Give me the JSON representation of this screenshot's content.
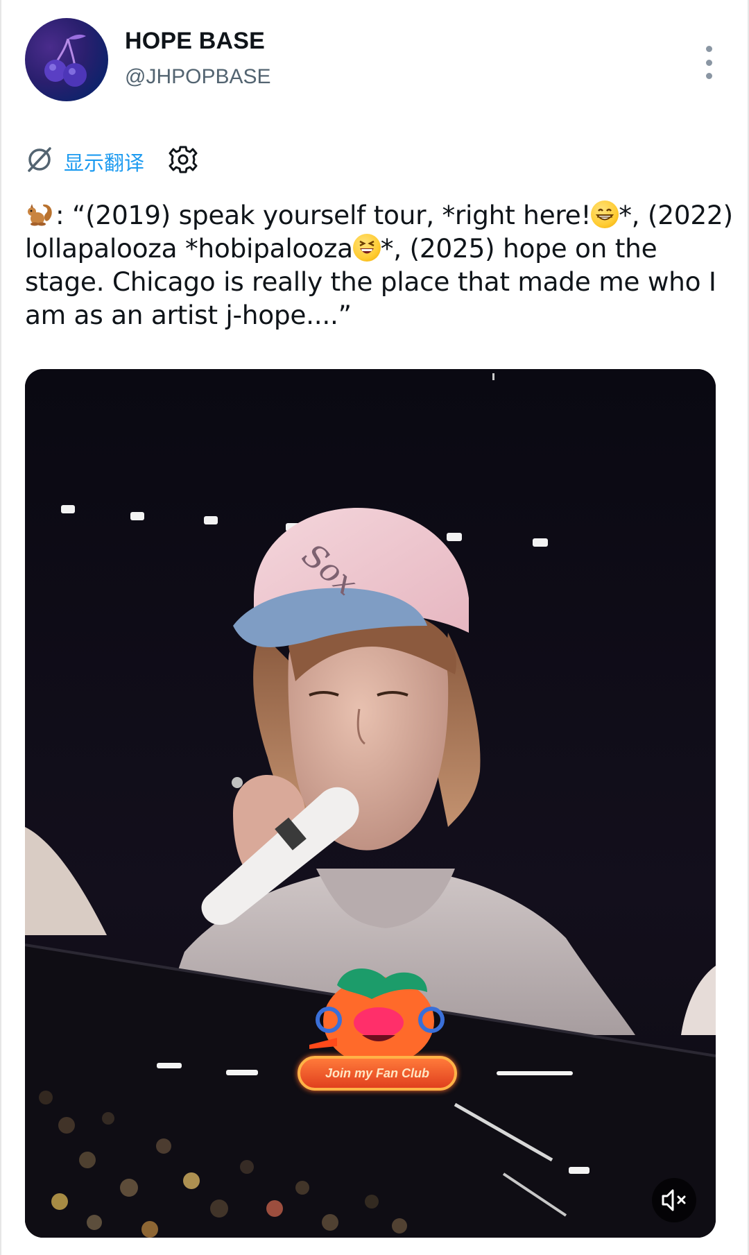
{
  "post": {
    "author": {
      "display_name": "HOPE BASE",
      "handle": "@JHPOPBASE",
      "avatar_icon": "cherry-icon"
    },
    "more_icon": "more-vertical-icon",
    "translate": {
      "label": "显示翻译",
      "icon": "translate-slash-icon",
      "settings_icon": "gear-icon"
    },
    "text_lines": [
      [
        ": “(2019) speak yourself tour, *right here!",
        "*, (2022)"
      ],
      [
        "lollapalooza *hobipalooza",
        "*, (2025) hope on the"
      ],
      [
        "stage. Chicago is really the place that made me who I"
      ],
      [
        "am as an artist j-hope....”"
      ]
    ],
    "media": {
      "type": "video",
      "overlay_badge": "Join my Fan Club",
      "mute_icon": "volume-muted-icon",
      "cap_logo": "Sox"
    }
  },
  "colors": {
    "accent": "#1d9bf0",
    "text_primary": "#0f1419",
    "text_secondary": "#536471"
  }
}
